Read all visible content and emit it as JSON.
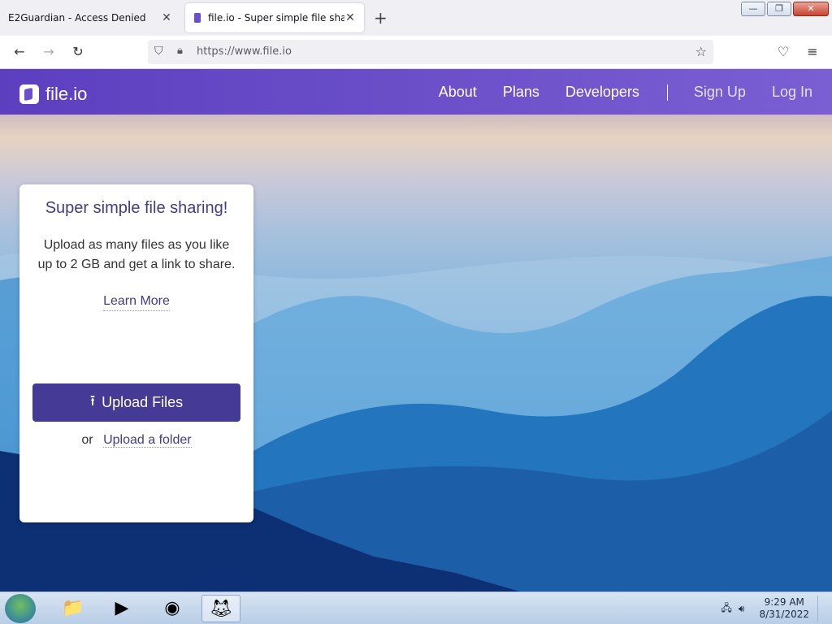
{
  "browser": {
    "tabs": [
      {
        "title": "E2Guardian - Access Denied",
        "active": false
      },
      {
        "title": "file.io - Super simple file sharing",
        "active": true
      }
    ],
    "new_tab_icon": "plus-icon",
    "url": "https://www.file.io",
    "window_controls": {
      "minimize": "minimize-icon",
      "restore": "restore-icon",
      "close": "close-icon"
    }
  },
  "site": {
    "logo": "file.io",
    "nav": {
      "about": "About",
      "plans": "Plans",
      "developers": "Developers",
      "signup": "Sign Up",
      "login": "Log In"
    },
    "card": {
      "title": "Super simple file sharing!",
      "description": "Upload as many files as you like up to 2 GB and get a link to share.",
      "learn_more": "Learn More",
      "upload_button": "Upload Files",
      "or": "or",
      "upload_folder": "Upload a folder"
    }
  },
  "taskbar": {
    "apps": [
      "windows-explorer-icon",
      "media-player-icon",
      "chrome-icon",
      "firefox-icon"
    ],
    "clock": {
      "time": "9:29 AM",
      "date": "8/31/2022"
    }
  }
}
